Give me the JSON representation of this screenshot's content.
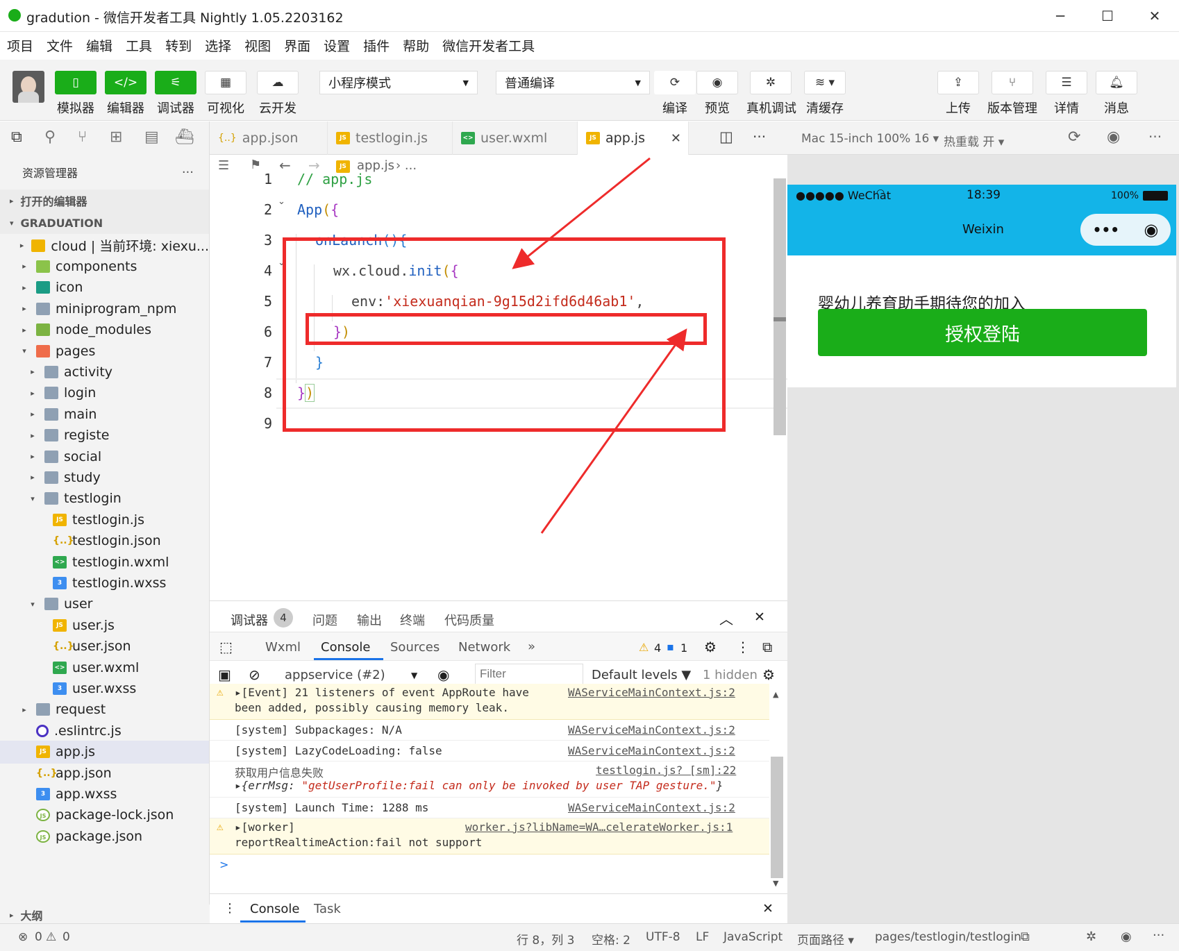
{
  "window": {
    "title": "gradution - 微信开发者工具 Nightly 1.05.2203162"
  },
  "menu": [
    "项目",
    "文件",
    "编辑",
    "工具",
    "转到",
    "选择",
    "视图",
    "界面",
    "设置",
    "插件",
    "帮助",
    "微信开发者工具"
  ],
  "toolbar": {
    "simulator": "模拟器",
    "editor": "编辑器",
    "debugger": "调试器",
    "visual": "可视化",
    "cloud": "云开发",
    "mode_select": "小程序模式",
    "compile_select": "普通编译",
    "compile": "编译",
    "preview": "预览",
    "real_debug": "真机调试",
    "clear_cache": "清缓存",
    "upload": "上传",
    "version": "版本管理",
    "details": "详情",
    "messages": "消息"
  },
  "explorer": {
    "title": "资源管理器",
    "open_editors": "打开的编辑器",
    "project": "GRADUATION",
    "outline": "大纲",
    "tree": [
      {
        "label": "cloud | 当前环境: xiexu...",
        "indent": 0,
        "type": "cloud",
        "caret": "▸"
      },
      {
        "label": "components",
        "indent": 0,
        "type": "comp",
        "caret": "▸"
      },
      {
        "label": "icon",
        "indent": 0,
        "type": "iconf",
        "caret": "▸"
      },
      {
        "label": "miniprogram_npm",
        "indent": 0,
        "type": "folder",
        "caret": "▸"
      },
      {
        "label": "node_modules",
        "indent": 0,
        "type": "node",
        "caret": "▸"
      },
      {
        "label": "pages",
        "indent": 0,
        "type": "pages",
        "caret": "▾"
      },
      {
        "label": "activity",
        "indent": 1,
        "type": "folder",
        "caret": "▸"
      },
      {
        "label": "login",
        "indent": 1,
        "type": "folder",
        "caret": "▸"
      },
      {
        "label": "main",
        "indent": 1,
        "type": "folder",
        "caret": "▸"
      },
      {
        "label": "registe",
        "indent": 1,
        "type": "folder",
        "caret": "▸"
      },
      {
        "label": "social",
        "indent": 1,
        "type": "folder",
        "caret": "▸"
      },
      {
        "label": "study",
        "indent": 1,
        "type": "folder",
        "caret": "▸"
      },
      {
        "label": "testlogin",
        "indent": 1,
        "type": "folder",
        "caret": "▾"
      },
      {
        "label": "testlogin.js",
        "indent": 2,
        "type": "js",
        "caret": ""
      },
      {
        "label": "testlogin.json",
        "indent": 2,
        "type": "json",
        "caret": ""
      },
      {
        "label": "testlogin.wxml",
        "indent": 2,
        "type": "wxml",
        "caret": ""
      },
      {
        "label": "testlogin.wxss",
        "indent": 2,
        "type": "wxss",
        "caret": ""
      },
      {
        "label": "user",
        "indent": 1,
        "type": "folder",
        "caret": "▾"
      },
      {
        "label": "user.js",
        "indent": 2,
        "type": "js",
        "caret": ""
      },
      {
        "label": "user.json",
        "indent": 2,
        "type": "json",
        "caret": ""
      },
      {
        "label": "user.wxml",
        "indent": 2,
        "type": "wxml",
        "caret": ""
      },
      {
        "label": "user.wxss",
        "indent": 2,
        "type": "wxss",
        "caret": ""
      },
      {
        "label": "request",
        "indent": 0,
        "type": "folder",
        "caret": "▸"
      },
      {
        "label": ".eslintrc.js",
        "indent": 0,
        "type": "eslint",
        "caret": ""
      },
      {
        "label": "app.js",
        "indent": 0,
        "type": "js",
        "caret": "",
        "selected": true
      },
      {
        "label": "app.json",
        "indent": 0,
        "type": "json",
        "caret": ""
      },
      {
        "label": "app.wxss",
        "indent": 0,
        "type": "wxss",
        "caret": ""
      },
      {
        "label": "package-lock.json",
        "indent": 0,
        "type": "npmj",
        "caret": ""
      },
      {
        "label": "package.json",
        "indent": 0,
        "type": "npmj",
        "caret": ""
      }
    ]
  },
  "tabs": [
    {
      "label": "app.json",
      "icon": "{..}"
    },
    {
      "label": "testlogin.js",
      "icon": "JS"
    },
    {
      "label": "user.wxml",
      "icon": "wxml"
    },
    {
      "label": "app.js",
      "icon": "JS",
      "active": true
    }
  ],
  "breadcrumb": {
    "file": "app.js",
    "rest": "› ..."
  },
  "code": {
    "line_numbers": [
      "1",
      "2",
      "3",
      "4",
      "5",
      "6",
      "7",
      "8",
      "9"
    ],
    "l1": "// app.js",
    "l2a": "App",
    "l2b": "(",
    "l2c": "{",
    "l3a": "onLaunch",
    "l3b": "()",
    "l3c": "{",
    "l4a": "wx.cloud.",
    "l4b": "init",
    "l4c": "(",
    "l4d": "{",
    "l5a": "env:",
    "l5b": "'xiexuanqian-9g15d2ifd6d46ab1'",
    "l5c": ",",
    "l6a": "}",
    "l6b": ")",
    "l7": "}",
    "l8a": "}",
    "l8b": ")"
  },
  "simulator": {
    "device": "Mac 15-inch 100% 16 ▾",
    "hot_reload": "热重载 开 ▾",
    "signal": "●●●●● WeChat",
    "time": "18:39",
    "battery": "100%",
    "nav_title": "Weixin",
    "heading": "婴幼儿养育助手期待您的加入",
    "auth_button": "授权登陆",
    "page_path_label": "页面路径 ▾",
    "page_path": "pages/testlogin/testlogin"
  },
  "devtools": {
    "tabs": [
      "调试器",
      "问题",
      "输出",
      "终端",
      "代码质量"
    ],
    "badge": "4",
    "inner_tabs": [
      "Wxml",
      "Console",
      "Sources",
      "Network"
    ],
    "more": "»",
    "warn_count": "4",
    "info_count": "1",
    "context": "appservice (#2)",
    "filter_placeholder": "Filter",
    "levels": "Default levels ▼",
    "hidden": "1 hidden",
    "logs": [
      {
        "text": "▸[Event] 21 listeners of event AppRoute have",
        "text2": "been added, possibly causing memory leak.",
        "link": "WAServiceMainContext.js:2"
      },
      {
        "text": "[system] Subpackages: N/A",
        "link": "WAServiceMainContext.js:2"
      },
      {
        "text": "[system] LazyCodeLoading: false",
        "link": "WAServiceMainContext.js:2"
      },
      {
        "text": "获取用户信息失败",
        "text2a": "▸{errMsg: ",
        "text2b": "\"getUserProfile:fail can only be invoked by user TAP gesture.\"",
        "text2c": "}",
        "link": "testlogin.js? [sm]:22"
      },
      {
        "text": "[system] Launch Time: 1288 ms",
        "link": "WAServiceMainContext.js:2"
      },
      {
        "text": "▸[worker]",
        "text2": "reportRealtimeAction:fail not support",
        "link": "worker.js?libName=WA…celerateWorker.js:1"
      }
    ],
    "prompt": ">",
    "bottom_tabs": [
      "Console",
      "Task"
    ]
  },
  "status": {
    "errors": "0",
    "warnings": "0",
    "position": "行 8，列 3",
    "spaces": "空格: 2",
    "encoding": "UTF-8",
    "eol": "LF",
    "language": "JavaScript"
  }
}
